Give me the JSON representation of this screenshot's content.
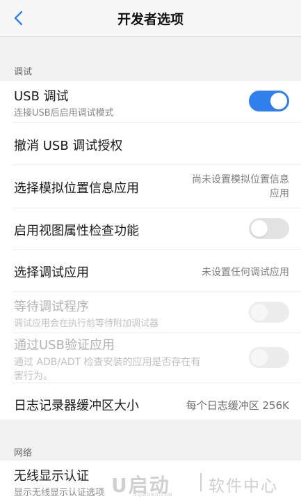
{
  "header": {
    "title": "开发者选项",
    "back_icon": "chevron-left-icon"
  },
  "sections": {
    "debug": {
      "label": "调试",
      "rows": {
        "usb_debug": {
          "label": "USB 调试",
          "sub": "连接USB后启用调试模式",
          "toggle": "on"
        },
        "revoke_usb": {
          "label": "撤消 USB 调试授权"
        },
        "mock_location": {
          "label": "选择模拟位置信息应用",
          "value_line1": "尚未设置模拟位置信息",
          "value_line2": "应用"
        },
        "view_attr": {
          "label": "启用视图属性检查功能",
          "toggle": "off"
        },
        "debug_app": {
          "label": "选择调试应用",
          "value": "未设置任何调试应用"
        },
        "wait_debugger": {
          "label": "等待调试程序",
          "sub": "调试应用会在执行前等待附加调试器",
          "toggle": "off-disabled"
        },
        "verify_usb": {
          "label": "通过USB验证应用",
          "sub_line1": "通过 ADB/ADT 检查安装的应用是否存在有",
          "sub_line2": "害行为。",
          "toggle": "off-disabled"
        },
        "logger_buffer": {
          "label": "日志记录器缓冲区大小",
          "value": "每个日志缓冲区 256K"
        }
      }
    },
    "network": {
      "label": "网络",
      "rows": {
        "wireless_display": {
          "label": "无线显示认证",
          "sub": "显示无线显示认证选项"
        }
      }
    }
  },
  "watermark": {
    "logo": "U启动",
    "text": "软件中心",
    "url": "UQIDONG.COM"
  },
  "colors": {
    "accent": "#2f80ed",
    "background": "#f2f2f2",
    "card": "#ffffff"
  }
}
